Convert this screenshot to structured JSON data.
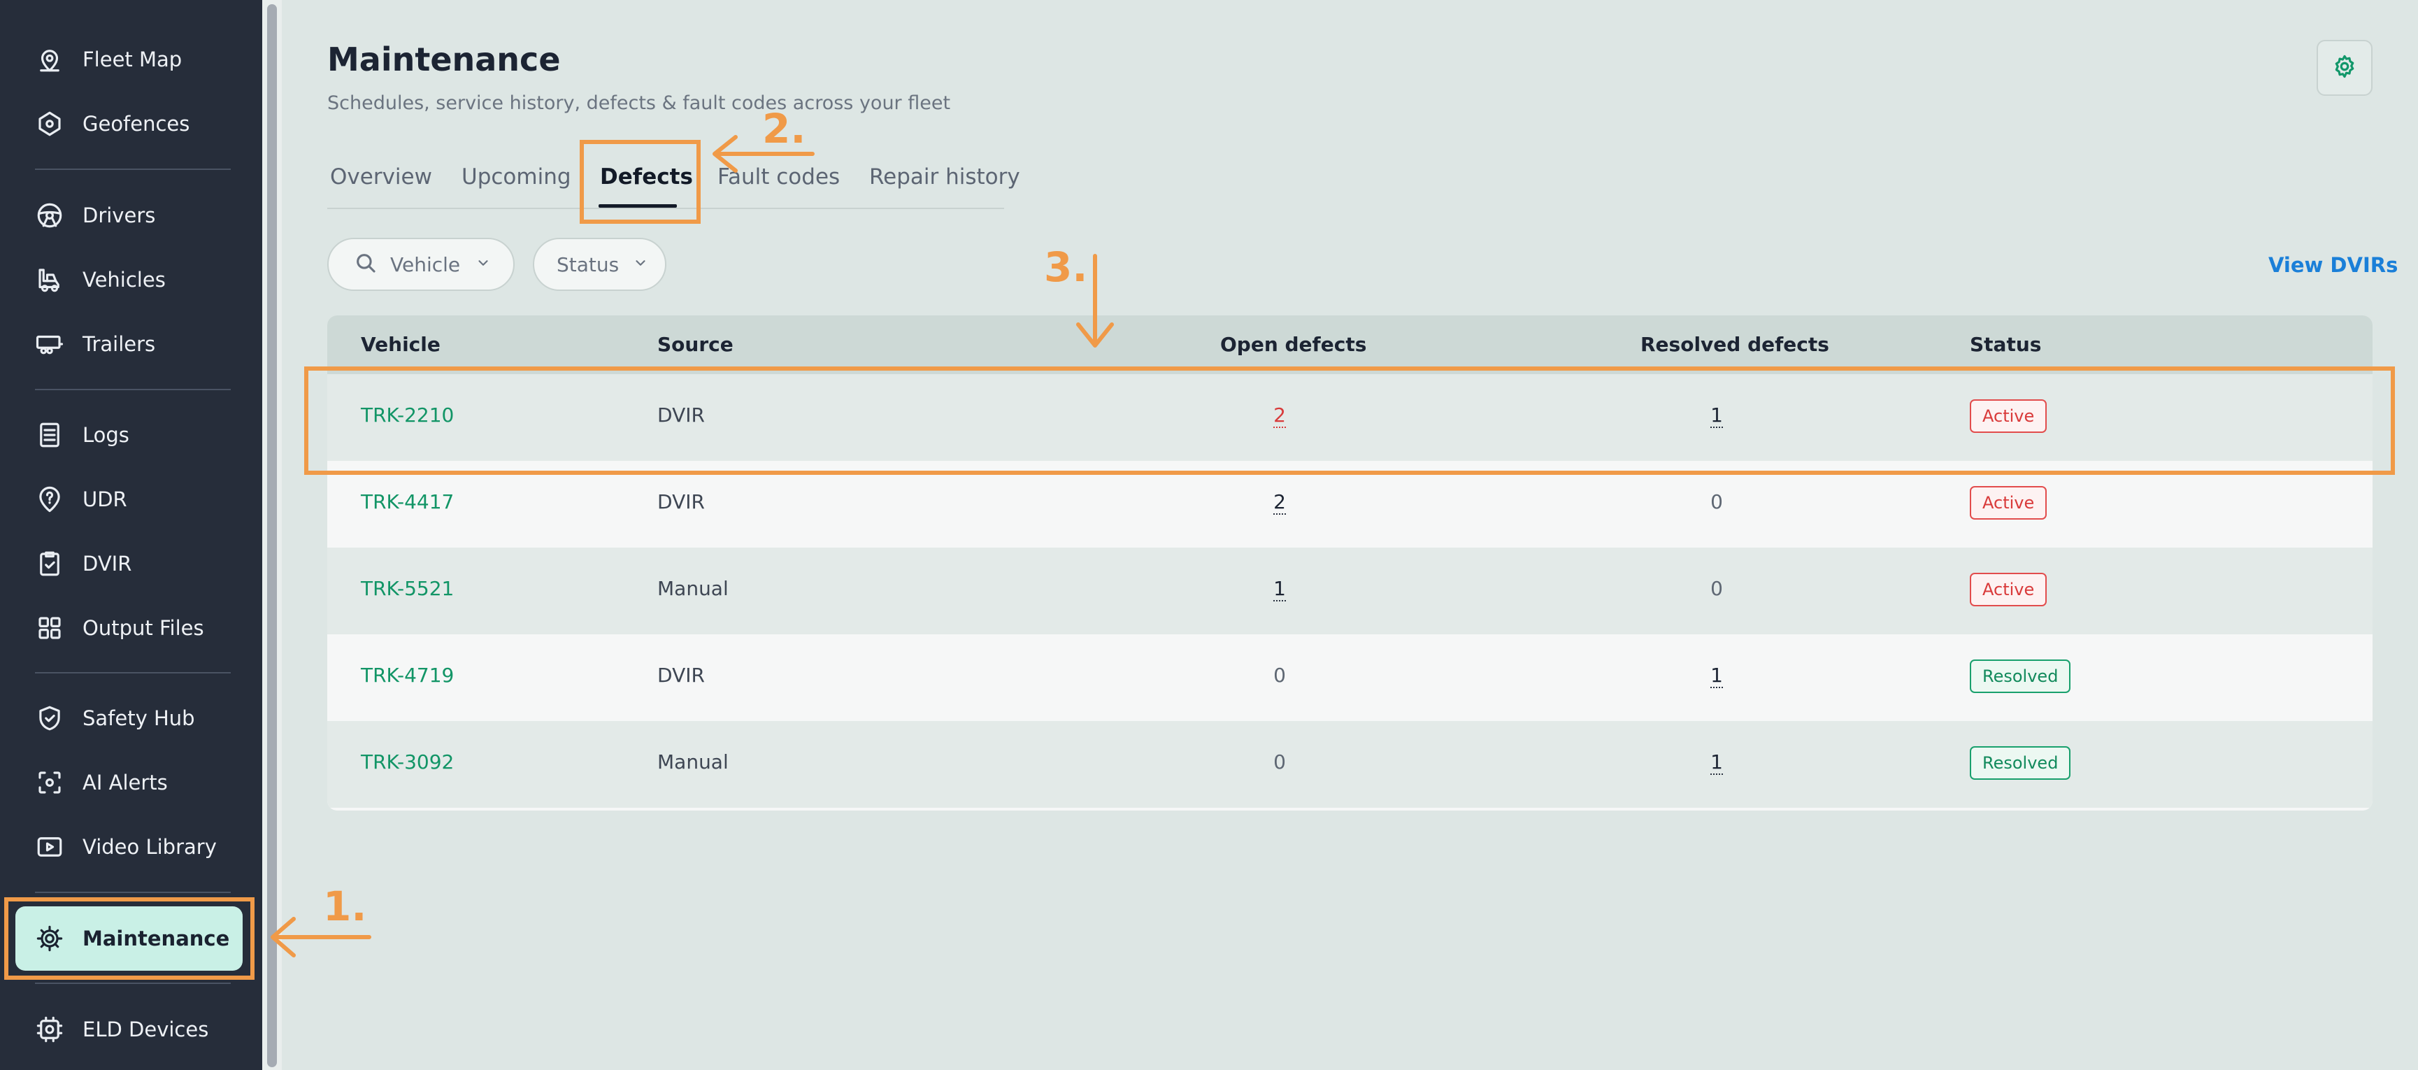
{
  "sidebar": {
    "items": [
      {
        "label": "Fleet Map",
        "icon": "map-pin-icon"
      },
      {
        "label": "Geofences",
        "icon": "geofence-icon"
      },
      {
        "label": "Drivers",
        "icon": "steering-wheel-icon"
      },
      {
        "label": "Vehicles",
        "icon": "truck-icon"
      },
      {
        "label": "Trailers",
        "icon": "trailer-icon"
      },
      {
        "label": "Logs",
        "icon": "logs-icon"
      },
      {
        "label": "UDR",
        "icon": "question-pin-icon"
      },
      {
        "label": "DVIR",
        "icon": "clipboard-check-icon"
      },
      {
        "label": "Output Files",
        "icon": "grid-icon"
      },
      {
        "label": "Safety Hub",
        "icon": "shield-check-icon"
      },
      {
        "label": "AI Alerts",
        "icon": "ai-scan-icon"
      },
      {
        "label": "Video Library",
        "icon": "video-icon"
      },
      {
        "label": "Maintenance",
        "icon": "maintenance-gear-icon",
        "active": true
      },
      {
        "label": "ELD Devices",
        "icon": "eld-device-icon"
      }
    ]
  },
  "header": {
    "title": "Maintenance",
    "subtitle": "Schedules, service history, defects & fault codes across your fleet"
  },
  "tabs": [
    {
      "label": "Overview"
    },
    {
      "label": "Upcoming"
    },
    {
      "label": "Defects",
      "active": true
    },
    {
      "label": "Fault codes"
    },
    {
      "label": "Repair history"
    }
  ],
  "filters": {
    "vehicle_label": "Vehicle",
    "status_label": "Status",
    "view_link": "View DVIRs"
  },
  "table": {
    "columns": [
      "Vehicle",
      "Source",
      "Open defects",
      "Resolved defects",
      "Status"
    ],
    "rows": [
      {
        "vehicle": "TRK-2210",
        "source": "DVIR",
        "open": "2",
        "resolved": "1",
        "status": "Active"
      },
      {
        "vehicle": "TRK-4417",
        "source": "DVIR",
        "open": "2",
        "resolved": "0",
        "status": "Active"
      },
      {
        "vehicle": "TRK-5521",
        "source": "Manual",
        "open": "1",
        "resolved": "0",
        "status": "Active"
      },
      {
        "vehicle": "TRK-4719",
        "source": "DVIR",
        "open": "0",
        "resolved": "1",
        "status": "Resolved"
      },
      {
        "vehicle": "TRK-3092",
        "source": "Manual",
        "open": "0",
        "resolved": "1",
        "status": "Resolved"
      }
    ]
  },
  "annotations": {
    "step1": "1.",
    "step2": "2.",
    "step3": "3."
  },
  "colors": {
    "sidebar_bg": "#262d3a",
    "accent_green": "#129566",
    "annotation_orange": "#f09a48",
    "active_red": "#d93a3a",
    "link_blue": "#1a7fd8"
  }
}
